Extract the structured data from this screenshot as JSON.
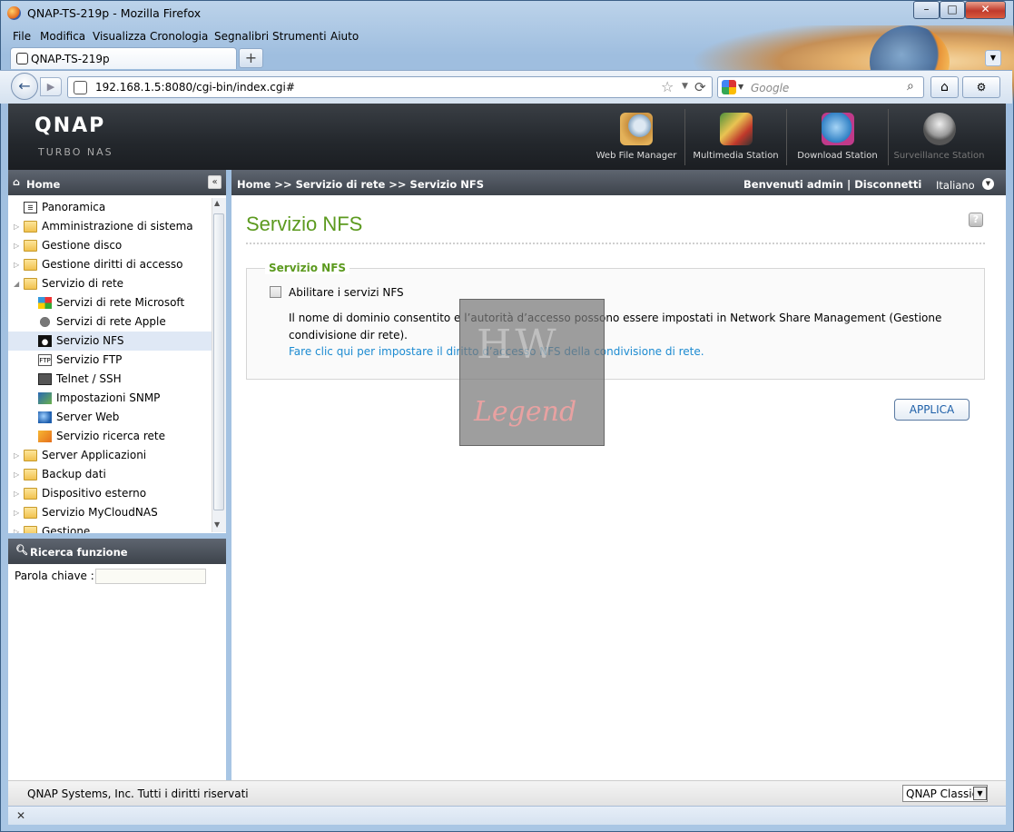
{
  "window": {
    "title": "QNAP-TS-219p - Mozilla Firefox",
    "minimize": "–",
    "maximize": "□",
    "close": "✕"
  },
  "menu": [
    "File",
    "Modifica",
    "Visualizza",
    "Cronologia",
    "Segnalibri",
    "Strumenti",
    "Aiuto"
  ],
  "tab": {
    "title": "QNAP-TS-219p",
    "new_tab": "+",
    "list": "▼"
  },
  "nav": {
    "back": "←",
    "forward": "▶",
    "url": "192.168.1.5:8080/cgi-bin/index.cgi#",
    "star": "☆",
    "reload": "⟳",
    "search_placeholder": "Google",
    "home": "⌂",
    "addon": "⚙"
  },
  "brand": {
    "logo": "QNAP",
    "sub": "TURBO NAS"
  },
  "apps": [
    "Web File Manager",
    "Multimedia Station",
    "Download Station",
    "Surveillance Station"
  ],
  "sidebar": {
    "home": "Home",
    "collapse": "«",
    "items": [
      {
        "label": "Panoramica",
        "level": 1,
        "icon": "panoramica-icon"
      },
      {
        "label": "Amministrazione di sistema",
        "level": 1,
        "icon": "folder-icon"
      },
      {
        "label": "Gestione disco",
        "level": 1,
        "icon": "folder-icon"
      },
      {
        "label": "Gestione diritti di accesso",
        "level": 1,
        "icon": "folder-icon"
      },
      {
        "label": "Servizio di rete",
        "level": 1,
        "icon": "folder-open-icon"
      },
      {
        "label": "Servizi di rete Microsoft",
        "level": 2,
        "icon": "windows-icon"
      },
      {
        "label": "Servizi di rete Apple",
        "level": 2,
        "icon": "apple-icon"
      },
      {
        "label": "Servizio NFS",
        "level": 2,
        "icon": "linux-icon"
      },
      {
        "label": "Servizio FTP",
        "level": 2,
        "icon": "ftp-icon"
      },
      {
        "label": "Telnet / SSH",
        "level": 2,
        "icon": "terminal-icon"
      },
      {
        "label": "Impostazioni SNMP",
        "level": 2,
        "icon": "snmp-icon"
      },
      {
        "label": "Server Web",
        "level": 2,
        "icon": "web-icon"
      },
      {
        "label": "Servizio ricerca rete",
        "level": 2,
        "icon": "search-network-icon"
      },
      {
        "label": "Server Applicazioni",
        "level": 1,
        "icon": "folder-icon"
      },
      {
        "label": "Backup dati",
        "level": 1,
        "icon": "folder-icon"
      },
      {
        "label": "Dispositivo esterno",
        "level": 1,
        "icon": "folder-icon"
      },
      {
        "label": "Servizio MyCloudNAS",
        "level": 1,
        "icon": "folder-icon"
      },
      {
        "label": "Gestione",
        "level": 1,
        "icon": "folder-icon"
      }
    ],
    "search_title": "Ricerca funzione",
    "keyword_label": "Parola chiave :"
  },
  "header": {
    "breadcrumb": "Home >> Servizio di rete >> Servizio NFS",
    "welcome": "Benvenuti admin",
    "separator": "|",
    "logout": "Disconnetti",
    "language": "Italiano"
  },
  "main": {
    "title": "Servizio NFS",
    "help": "?",
    "section_title": "Servizio NFS",
    "enable_label": "Abilitare i servizi NFS",
    "description": "Il nome di dominio consentito e l’autorità d’accesso possono essere impostati in Network Share Management (Gestione condivisione dir rete).",
    "link": "Fare clic qui per impostare il diritto d’accesso NFS della condivisione di rete.",
    "apply_button": "APPLICA"
  },
  "watermark": {
    "top": "HW",
    "bottom": "Legend"
  },
  "footer": {
    "copyright": "QNAP Systems, Inc. Tutti i diritti riservati",
    "theme": "QNAP Classic"
  },
  "statusbar": {
    "close": "✕"
  }
}
